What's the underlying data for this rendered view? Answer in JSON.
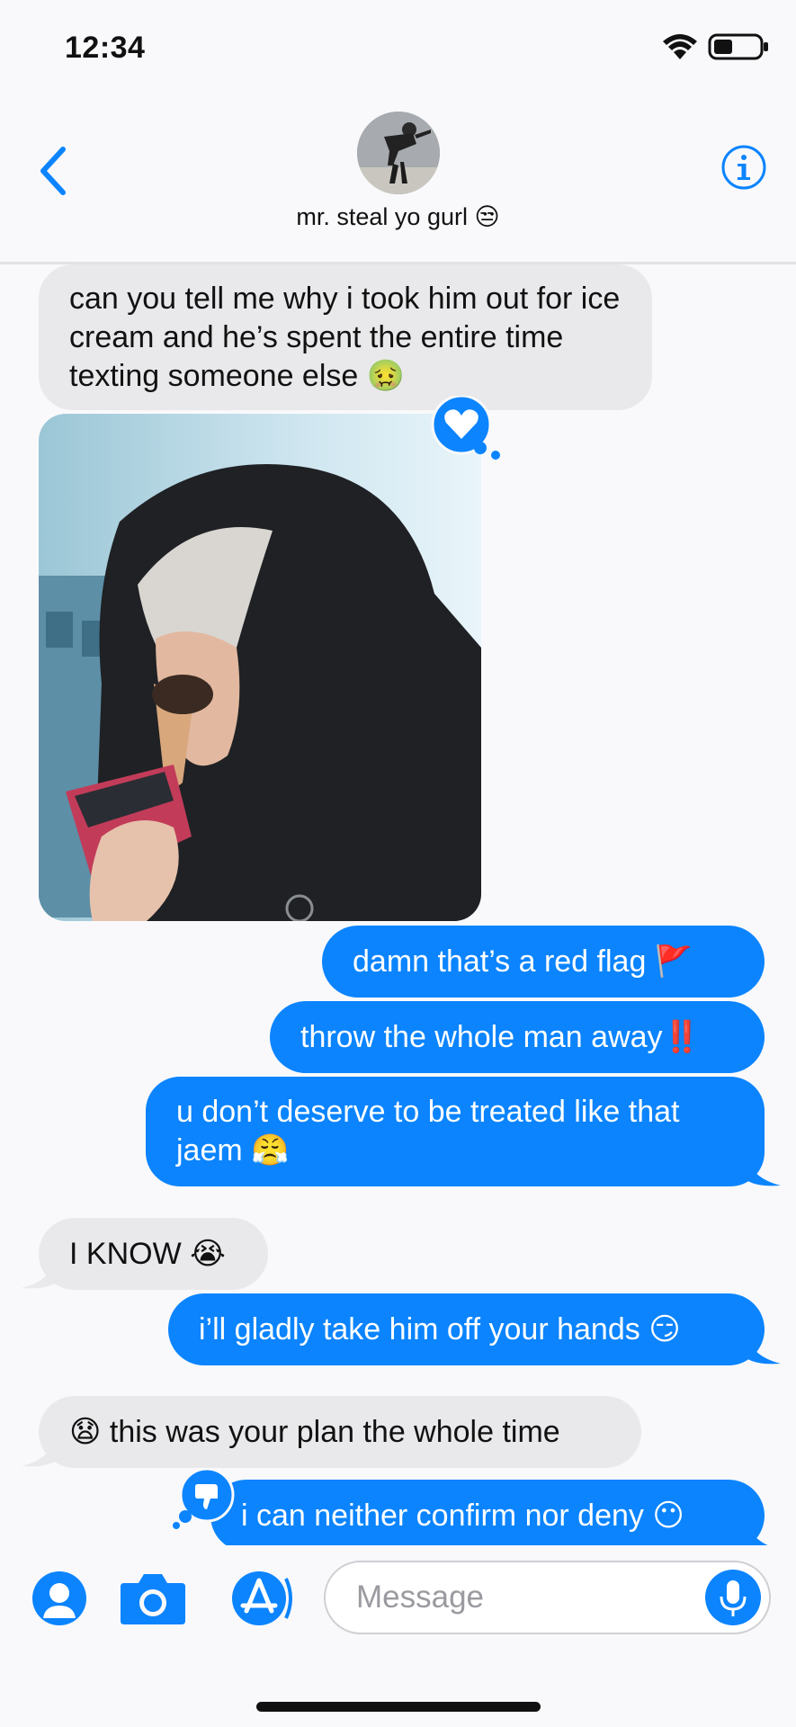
{
  "status_bar": {
    "time": "12:34"
  },
  "header": {
    "contact_name": "mr. steal yo gurl 😒"
  },
  "messages": [
    {
      "from": "them",
      "text": "can you tell me why i took him out for ice cream and he’s spent the entire time texting someone else 🤢"
    },
    {
      "from": "them",
      "type": "photo",
      "reaction": "heart"
    },
    {
      "from": "me",
      "text": "damn that’s a red flag 🚩"
    },
    {
      "from": "me",
      "text": "throw the whole man away‼️"
    },
    {
      "from": "me",
      "text": "u don’t deserve to be treated like that jaem 😤"
    },
    {
      "from": "them",
      "text": "I KNOW 😭"
    },
    {
      "from": "me",
      "text": "i’ll gladly take him off your hands 😏"
    },
    {
      "from": "them",
      "text": "😧 this was your plan the whole time"
    },
    {
      "from": "me",
      "text": "i can neither confirm nor deny 😶",
      "reaction": "thumbs-down"
    }
  ],
  "composer": {
    "placeholder": "Message"
  },
  "colors": {
    "outgoing": "#0b84fe",
    "incoming": "#e9e9eb",
    "accent": "#0b84fe"
  }
}
